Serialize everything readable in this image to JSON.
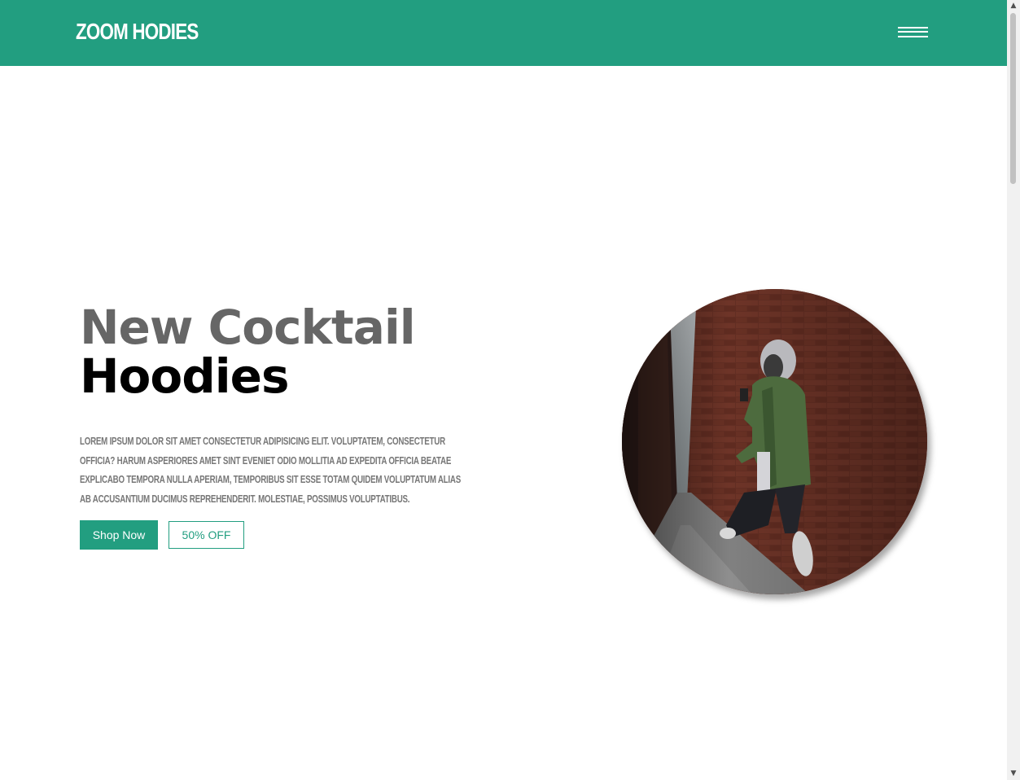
{
  "navbar": {
    "brand": "ZOOM HODIES",
    "menu_icon": "hamburger-menu-icon",
    "background": "#229e80"
  },
  "hero": {
    "title_line1": "New Cocktail",
    "title_line2": "Hoodies",
    "description": "Lorem ipsum dolor sit amet consectetur adipisicing elit. Voluptatem, consectetur officia? Harum asperiores amet sint eveniet odio mollitia ad expedita officia beatae explicabo tempora nulla aperiam, temporibus sit esse totam quidem voluptatum alias ab accusantium ducimus reprehenderit. Molestiae, possimus voluptatibus.",
    "primary_button": "Shop Now",
    "secondary_button": "50% OFF",
    "image_subject": "person-in-hoodie-alley-photo"
  },
  "colors": {
    "accent": "#229e80",
    "title_gray": "#666666",
    "title_black": "#000000",
    "body_text": "#777777"
  },
  "scrollbar": {
    "up_icon": "scroll-up-arrow-icon",
    "down_icon": "scroll-down-arrow-icon"
  }
}
